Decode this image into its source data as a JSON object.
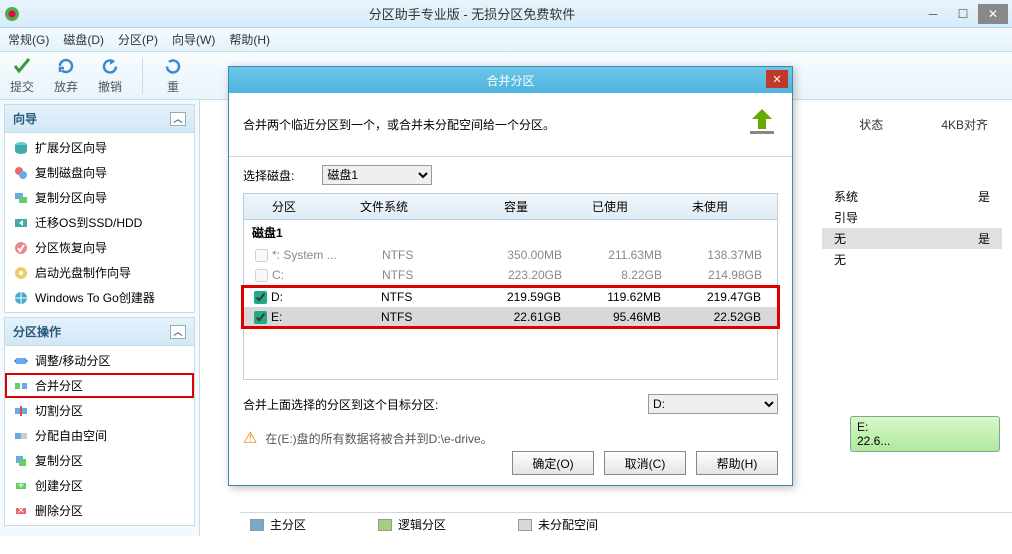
{
  "window": {
    "title": "分区助手专业版 - 无损分区免费软件"
  },
  "menu": {
    "general": "常规(G)",
    "disk": "磁盘(D)",
    "partition": "分区(P)",
    "wizard": "向导(W)",
    "help": "帮助(H)"
  },
  "toolbar": {
    "commit": "提交",
    "discard": "放弃",
    "undo": "撤销",
    "redo": "重"
  },
  "sidebar": {
    "wizard": {
      "title": "向导",
      "items": [
        "扩展分区向导",
        "复制磁盘向导",
        "复制分区向导",
        "迁移OS到SSD/HDD",
        "分区恢复向导",
        "启动光盘制作向导",
        "Windows To Go创建器"
      ]
    },
    "ops": {
      "title": "分区操作",
      "items": [
        "调整/移动分区",
        "合并分区",
        "切割分区",
        "分配自由空间",
        "复制分区",
        "创建分区",
        "删除分区"
      ]
    }
  },
  "maingrid": {
    "cols": {
      "status": "状态",
      "align": "4KB对齐"
    },
    "rows": [
      {
        "c1": "系统",
        "c2": "是"
      },
      {
        "c1": "引导",
        "c2": ""
      },
      {
        "c1": "无",
        "c2": "是",
        "sel": true
      },
      {
        "c1": "无",
        "c2": ""
      }
    ]
  },
  "diskbar": {
    "label": "E:",
    "size": "22.6..."
  },
  "legend": {
    "primary": "主分区",
    "logical": "逻辑分区",
    "unalloc": "未分配空间"
  },
  "dialog": {
    "title": "合并分区",
    "desc": "合并两个临近分区到一个，或合并未分配空间给一个分区。",
    "selectDiskLabel": "选择磁盘:",
    "selectedDisk": "磁盘1",
    "thead": {
      "partition": "分区",
      "fs": "文件系统",
      "cap": "容量",
      "used": "已使用",
      "free": "未使用"
    },
    "group": "磁盘1",
    "rows": [
      {
        "checked": false,
        "disabled": true,
        "name": "*: System ...",
        "fs": "NTFS",
        "cap": "350.00MB",
        "used": "211.63MB",
        "free": "138.37MB"
      },
      {
        "checked": false,
        "disabled": true,
        "name": "C:",
        "fs": "NTFS",
        "cap": "223.20GB",
        "used": "8.22GB",
        "free": "214.98GB"
      },
      {
        "checked": true,
        "disabled": false,
        "name": "D:",
        "fs": "NTFS",
        "cap": "219.59GB",
        "used": "119.62MB",
        "free": "219.47GB"
      },
      {
        "checked": true,
        "disabled": false,
        "sel": true,
        "name": "E:",
        "fs": "NTFS",
        "cap": "22.61GB",
        "used": "95.46MB",
        "free": "22.52GB"
      }
    ],
    "targetLabel": "合并上面选择的分区到这个目标分区:",
    "targetValue": "D:",
    "warn": "在(E:)盘的所有数据将被合并到D:\\e-drive。",
    "ok": "确定(O)",
    "cancel": "取消(C)",
    "help": "帮助(H)"
  }
}
